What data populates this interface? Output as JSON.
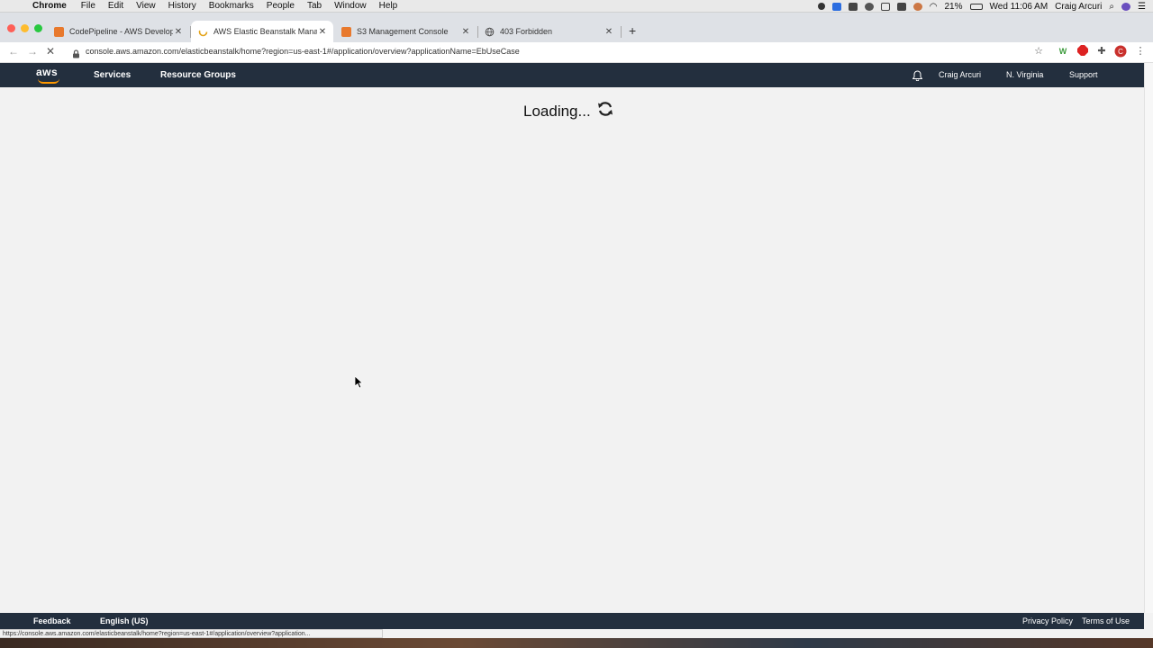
{
  "menubar": {
    "app_name": "Chrome",
    "items": [
      "File",
      "Edit",
      "View",
      "History",
      "Bookmarks",
      "People",
      "Tab",
      "Window",
      "Help"
    ],
    "battery": "21%",
    "clock": "Wed 11:06 AM",
    "user": "Craig Arcuri"
  },
  "tabs": [
    {
      "title": "CodePipeline - AWS Developer",
      "icon": "aws-cube-icon",
      "active": false
    },
    {
      "title": "AWS Elastic Beanstalk Manage",
      "icon": "loading-icon",
      "active": true
    },
    {
      "title": "S3 Management Console",
      "icon": "aws-cube-icon",
      "active": false
    },
    {
      "title": "403 Forbidden",
      "icon": "globe-icon",
      "active": false
    }
  ],
  "address_bar": {
    "url": "console.aws.amazon.com/elasticbeanstalk/home?region=us-east-1#/application/overview?applicationName=EbUseCase"
  },
  "aws_header": {
    "logo": "aws",
    "services": "Services",
    "resource_groups": "Resource Groups",
    "user": "Craig Arcuri",
    "region": "N. Virginia",
    "support": "Support"
  },
  "main": {
    "loading_text": "Loading..."
  },
  "footer": {
    "feedback": "Feedback",
    "language": "English (US)",
    "privacy": "Privacy Policy",
    "terms": "Terms of Use"
  },
  "status_url": "https://console.aws.amazon.com/elasticbeanstalk/home?region=us-east-1#/application/overview?application...",
  "colors": {
    "aws_nav": "#232f3e",
    "aws_orange": "#ff9900",
    "page_bg": "#f2f2f2"
  }
}
